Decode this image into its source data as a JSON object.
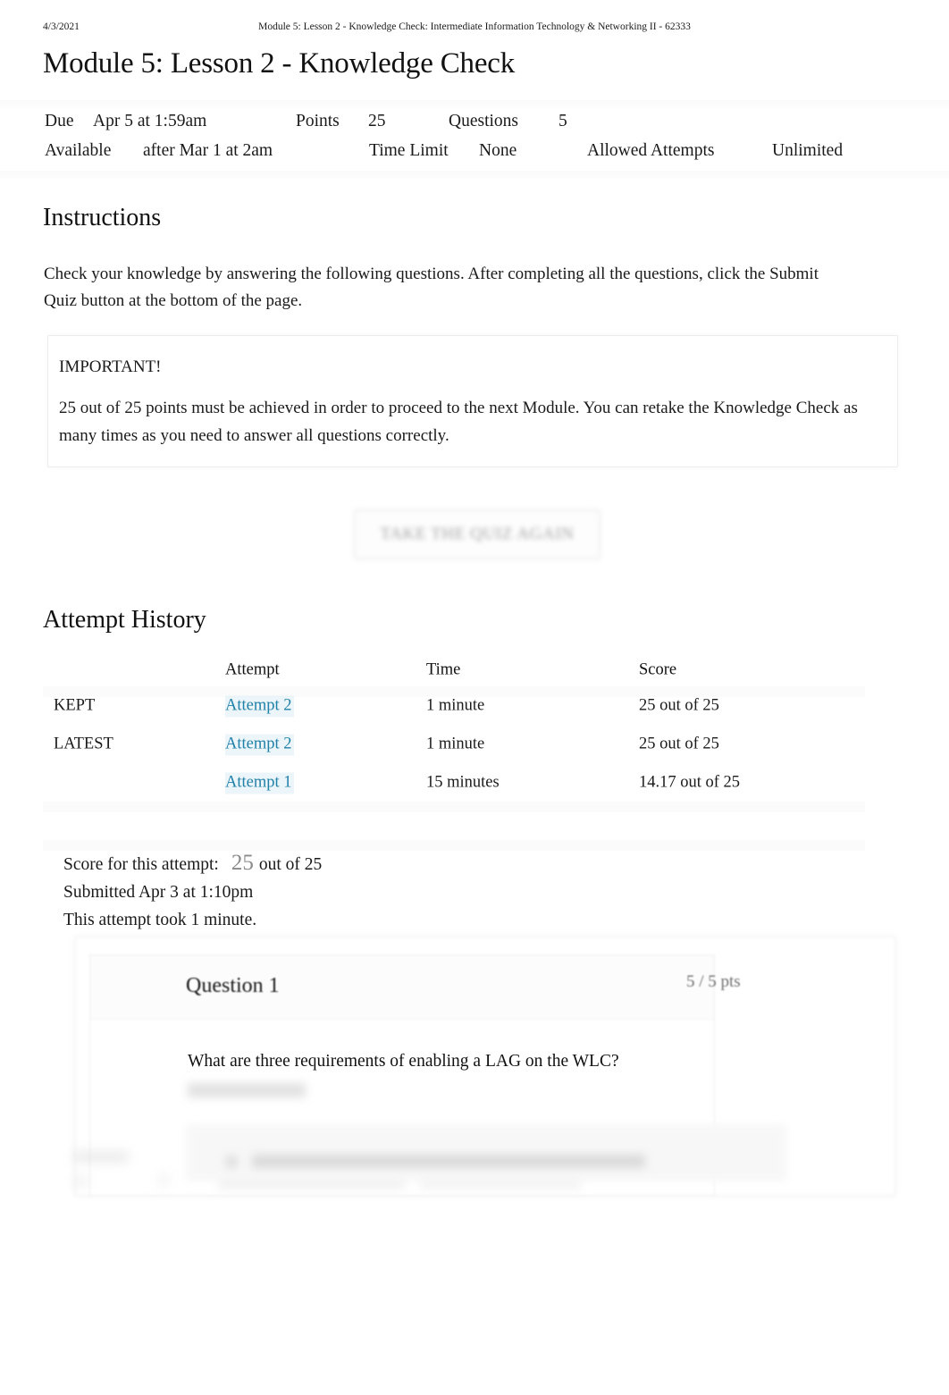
{
  "print_header": {
    "date": "4/3/2021",
    "title": "Module 5: Lesson 2 - Knowledge Check: Intermediate Information Technology & Networking II - 62333"
  },
  "page_title": "Module 5: Lesson 2 - Knowledge Check",
  "meta": {
    "due_label": "Due",
    "due_value": "Apr 5 at 1:59am",
    "points_label": "Points",
    "points_value": "25",
    "questions_label": "Questions",
    "questions_value": "5",
    "available_label": "Available",
    "available_value": "after Mar 1 at 2am",
    "time_limit_label": "Time Limit",
    "time_limit_value": "None",
    "allowed_attempts_label": "Allowed Attempts",
    "allowed_attempts_value": "Unlimited"
  },
  "instructions": {
    "heading": "Instructions",
    "body": "Check your knowledge by answering the following questions. After completing all the questions, click the Submit Quiz button at the bottom of the page."
  },
  "callout": {
    "title": "IMPORTANT!",
    "text": "25 out of 25 points must be achieved in order to proceed to the next Module. You can retake the Knowledge Check as many times as you need to answer all questions correctly."
  },
  "retake_button": {
    "label": "TAKE THE QUIZ AGAIN"
  },
  "attempt_history": {
    "heading": "Attempt History",
    "columns": {
      "label": "",
      "attempt": "Attempt",
      "time": "Time",
      "score": "Score"
    },
    "rows": [
      {
        "label": "KEPT",
        "attempt": "Attempt 2",
        "time": "1 minute",
        "score": "25 out of 25"
      },
      {
        "label": "LATEST",
        "attempt": "Attempt 2",
        "time": "1 minute",
        "score": "25 out of 25"
      },
      {
        "label": "",
        "attempt": "Attempt 1",
        "time": "15 minutes",
        "score": "14.17 out of 25"
      }
    ]
  },
  "score_summary": {
    "score_label": "Score for this attempt:",
    "score_value": "25",
    "score_out_of": "out of 25",
    "submitted": "Submitted Apr 3 at 1:10pm",
    "duration": "This attempt took 1 minute."
  },
  "question": {
    "title": "Question 1",
    "points": "5 / 5 pts",
    "text": "What are three requirements of enabling a LAG on the WLC?"
  },
  "colors": {
    "link_blue": "#2180a8",
    "muted_grey": "#8a8a8a",
    "text": "#1a1a1a",
    "border": "#ececec"
  }
}
